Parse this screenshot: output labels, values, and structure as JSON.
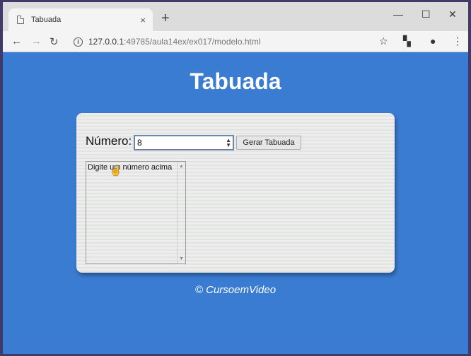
{
  "browser": {
    "tab_title": "Tabuada",
    "tab_close": "×",
    "new_tab": "+",
    "win_min": "—",
    "win_max": "☐",
    "win_close": "✕",
    "url_host": "127.0.0.1",
    "url_path": ":49785/aula14ex/ex017/modelo.html",
    "back": "←",
    "forward": "→",
    "reload": "↻",
    "star": "☆",
    "ext": "▚",
    "account": "●",
    "menu": "⋮"
  },
  "page": {
    "title": "Tabuada",
    "number_label": "Número:",
    "number_value": "8",
    "generate_button": "Gerar Tabuada",
    "list_placeholder": "Digite um número acima",
    "footer": "© CursoemVideo"
  },
  "colors": {
    "page_background": "#3b7cd3",
    "panel_background": "#ededed"
  }
}
